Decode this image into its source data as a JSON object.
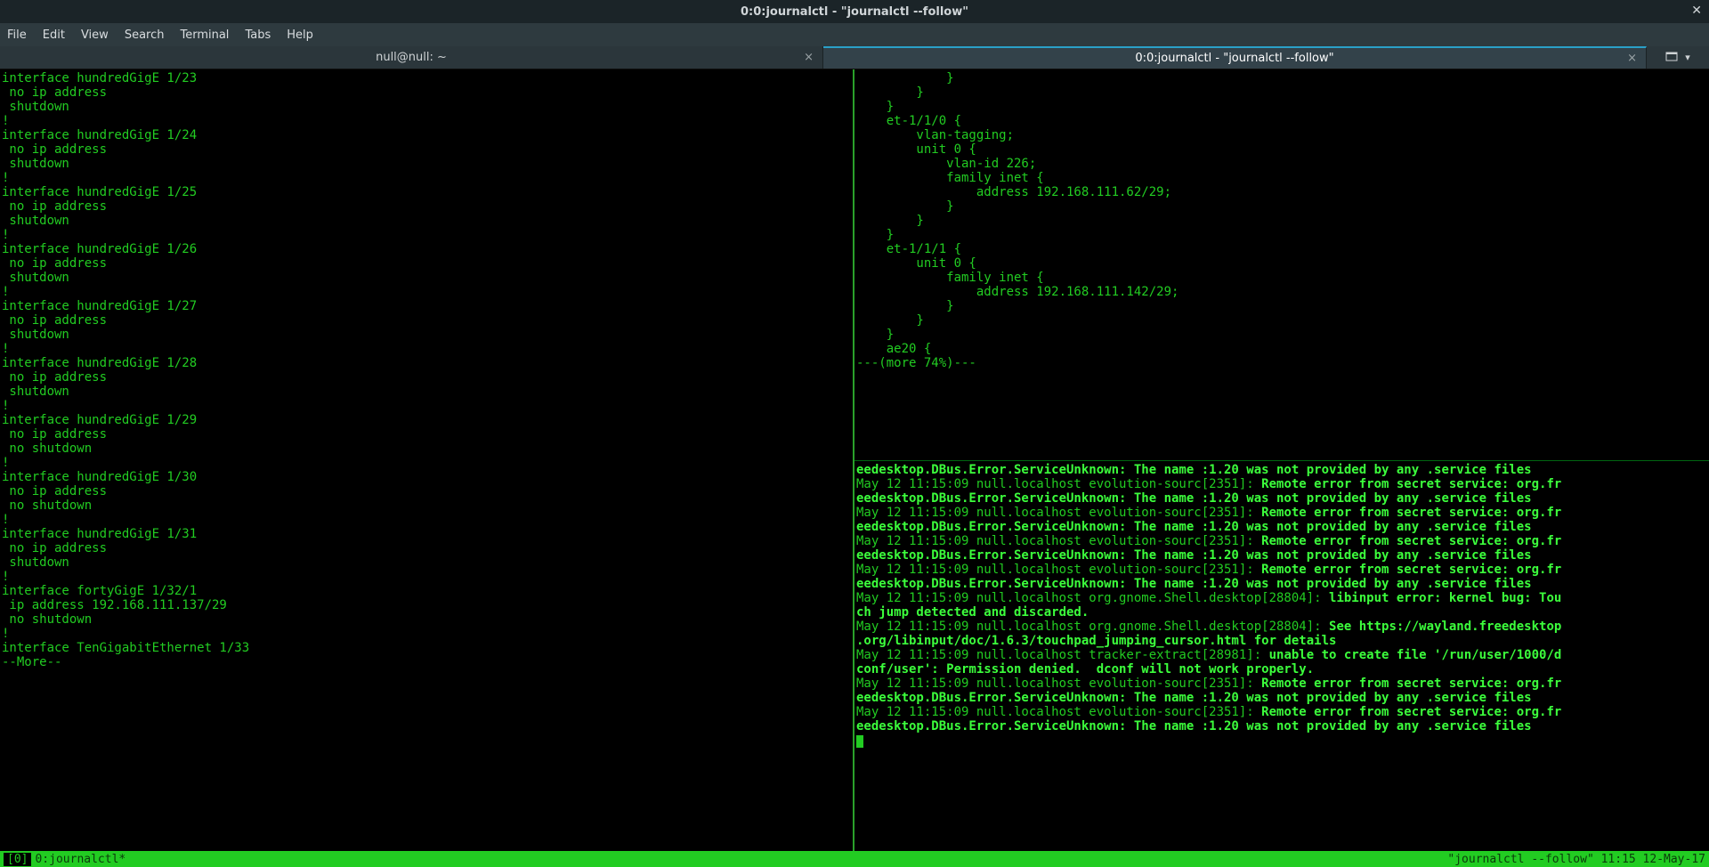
{
  "titlebar": {
    "title": "0:0:journalctl - \"journalctl --follow\""
  },
  "menu": {
    "file": "File",
    "edit": "Edit",
    "view": "View",
    "search": "Search",
    "terminal": "Terminal",
    "tabs": "Tabs",
    "help": "Help"
  },
  "tabs": {
    "left": {
      "label": "null@null: ~"
    },
    "right": {
      "label": "0:0:journalctl - \"journalctl --follow\""
    }
  },
  "left_pane": "interface hundredGigE 1/23\n no ip address\n shutdown\n!\ninterface hundredGigE 1/24\n no ip address\n shutdown\n!\ninterface hundredGigE 1/25\n no ip address\n shutdown\n!\ninterface hundredGigE 1/26\n no ip address\n shutdown\n!\ninterface hundredGigE 1/27\n no ip address\n shutdown\n!\ninterface hundredGigE 1/28\n no ip address\n shutdown\n!\ninterface hundredGigE 1/29\n no ip address\n no shutdown\n!\ninterface hundredGigE 1/30\n no ip address\n no shutdown\n!\ninterface hundredGigE 1/31\n no ip address\n shutdown\n!\ninterface fortyGigE 1/32/1\n ip address 192.168.111.137/29\n no shutdown\n!\ninterface TenGigabitEthernet 1/33\n--More--",
  "right_top": "            }\n        }\n    }\n    et-1/1/0 {\n        vlan-tagging;\n        unit 0 {\n            vlan-id 226;\n            family inet {\n                address 192.168.111.62/29;\n            }\n        }\n    }\n    et-1/1/1 {\n        unit 0 {\n            family inet {\n                address 192.168.111.142/29;\n            }\n        }\n    }\n    ae20 {\n---(more 74%)---",
  "right_bottom_lines": [
    {
      "pre": "",
      "bold": "eedesktop.DBus.Error.ServiceUnknown: The name :1.20 was not provided by any .service files"
    },
    {
      "pre": "May 12 11:15:09 null.localhost evolution-sourc[2351]: ",
      "bold": "Remote error from secret service: org.fr"
    },
    {
      "pre": "",
      "bold": "eedesktop.DBus.Error.ServiceUnknown: The name :1.20 was not provided by any .service files"
    },
    {
      "pre": "May 12 11:15:09 null.localhost evolution-sourc[2351]: ",
      "bold": "Remote error from secret service: org.fr"
    },
    {
      "pre": "",
      "bold": "eedesktop.DBus.Error.ServiceUnknown: The name :1.20 was not provided by any .service files"
    },
    {
      "pre": "May 12 11:15:09 null.localhost evolution-sourc[2351]: ",
      "bold": "Remote error from secret service: org.fr"
    },
    {
      "pre": "",
      "bold": "eedesktop.DBus.Error.ServiceUnknown: The name :1.20 was not provided by any .service files"
    },
    {
      "pre": "May 12 11:15:09 null.localhost evolution-sourc[2351]: ",
      "bold": "Remote error from secret service: org.fr"
    },
    {
      "pre": "",
      "bold": "eedesktop.DBus.Error.ServiceUnknown: The name :1.20 was not provided by any .service files"
    },
    {
      "pre": "May 12 11:15:09 null.localhost org.gnome.Shell.desktop[28804]: ",
      "bold": "libinput error: kernel bug: Tou"
    },
    {
      "pre": "",
      "bold": "ch jump detected and discarded."
    },
    {
      "pre": "May 12 11:15:09 null.localhost org.gnome.Shell.desktop[28804]: ",
      "bold": "See https://wayland.freedesktop"
    },
    {
      "pre": "",
      "bold": ".org/libinput/doc/1.6.3/touchpad_jumping_cursor.html for details"
    },
    {
      "pre": "May 12 11:15:09 null.localhost tracker-extract[28981]: ",
      "bold": "unable to create file '/run/user/1000/d"
    },
    {
      "pre": "",
      "bold": "conf/user': Permission denied.  dconf will not work properly."
    },
    {
      "pre": "May 12 11:15:09 null.localhost evolution-sourc[2351]: ",
      "bold": "Remote error from secret service: org.fr"
    },
    {
      "pre": "",
      "bold": "eedesktop.DBus.Error.ServiceUnknown: The name :1.20 was not provided by any .service files"
    },
    {
      "pre": "May 12 11:15:09 null.localhost evolution-sourc[2351]: ",
      "bold": "Remote error from secret service: org.fr"
    },
    {
      "pre": "",
      "bold": "eedesktop.DBus.Error.ServiceUnknown: The name :1.20 was not provided by any .service files"
    }
  ],
  "tmux": {
    "session": "[0]",
    "window": "0:journalctl*",
    "right": "\"journalctl --follow\" 11:15 12-May-17"
  }
}
